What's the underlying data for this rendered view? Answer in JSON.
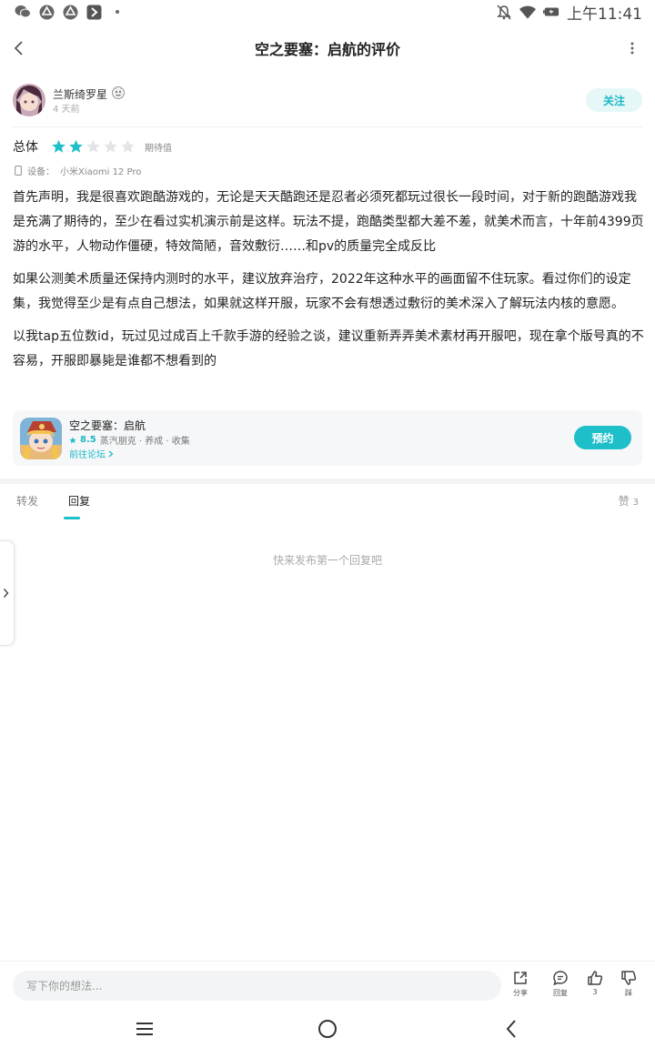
{
  "status_bar": {
    "time": "上午11:41"
  },
  "header": {
    "title": "空之要塞：启航的评价"
  },
  "author": {
    "name": "兰斯绮罗星",
    "time": "4 天前",
    "follow_label": "关注"
  },
  "rating": {
    "label": "总体",
    "stars_filled": 2,
    "stars_total": 5,
    "text": "期待值"
  },
  "device": {
    "label": "设备：",
    "model": "小米Xiaomi 12 Pro"
  },
  "review": {
    "paragraphs": [
      "首先声明，我是很喜欢跑酷游戏的，无论是天天酷跑还是忍者必须死都玩过很长一段时间，对于新的跑酷游戏我是充满了期待的，至少在看过实机演示前是这样。玩法不提，跑酷类型都大差不差，就美术而言，十年前4399页游的水平，人物动作僵硬，特效简陋，音效敷衍……和pv的质量完全成反比",
      "如果公测美术质量还保持内测时的水平，建议放弃治疗，2022年这种水平的画面留不住玩家。看过你们的设定集，我觉得至少是有点自己想法，如果就这样开服，玩家不会有想透过敷衍的美术深入了解玩法内核的意愿。",
      "以我tap五位数id，玩过见过成百上千款手游的经验之谈，建议重新弄弄美术素材再开服吧，现在拿个版号真的不容易，开服即暴毙是谁都不想看到的"
    ]
  },
  "game_card": {
    "name": "空之要塞：启航",
    "score": "8.5",
    "tags": "蒸汽朋克 · 养成 · 收集",
    "forum_link": "前往论坛",
    "reserve_label": "预约"
  },
  "tabs": {
    "items": [
      "转发",
      "回复"
    ],
    "active_index": 1,
    "likes_label": "赞",
    "likes_count": "3"
  },
  "replies": {
    "empty_text": "快来发布第一个回复吧"
  },
  "bottom_bar": {
    "input_placeholder": "写下你的想法...",
    "share_label": "分享",
    "reply_label": "回复",
    "like_count": "3",
    "dislike_label": "踩"
  },
  "colors": {
    "accent": "#1ebfc9",
    "accent_soft": "#e6f7f8",
    "star_empty": "#e2e4e6"
  },
  "icons": {
    "status_left": [
      "wechat-icon",
      "app-icon",
      "app-icon",
      "app-icon",
      "dot-icon"
    ],
    "status_right": [
      "mute-icon",
      "wifi-icon",
      "battery-icon"
    ],
    "nav": [
      "menu-icon",
      "home-icon",
      "back-icon"
    ]
  }
}
